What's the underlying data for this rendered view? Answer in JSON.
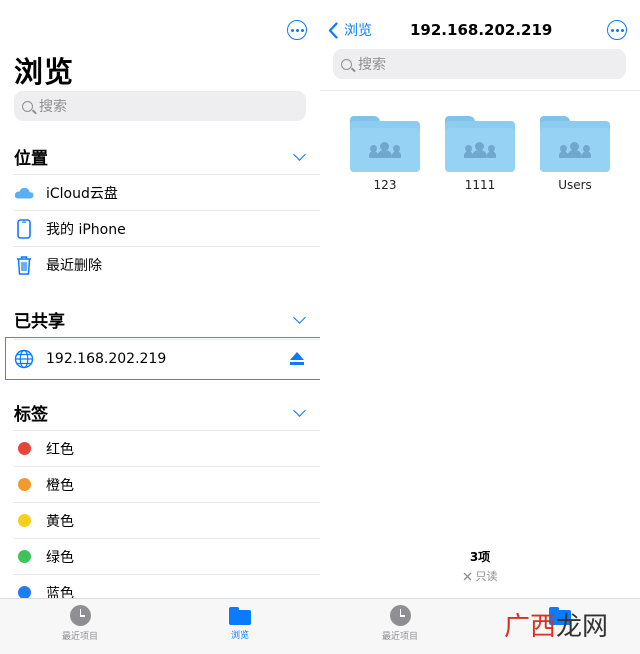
{
  "left": {
    "title": "浏览",
    "search_placeholder": "搜索",
    "sections": {
      "locations": {
        "label": "位置",
        "items": [
          {
            "label": "iCloud云盘",
            "icon": "icloud-icon"
          },
          {
            "label": "我的 iPhone",
            "icon": "iphone-icon"
          },
          {
            "label": "最近删除",
            "icon": "trash-icon"
          }
        ]
      },
      "shared": {
        "label": "已共享",
        "items": [
          {
            "label": "192.168.202.219",
            "icon": "globe-icon"
          }
        ]
      },
      "tags": {
        "label": "标签",
        "items": [
          {
            "label": "红色",
            "color": "#e5453a"
          },
          {
            "label": "橙色",
            "color": "#f29a2c"
          },
          {
            "label": "黄色",
            "color": "#f7ce1b"
          },
          {
            "label": "绿色",
            "color": "#3cc45b"
          },
          {
            "label": "蓝色",
            "color": "#1e7df0"
          }
        ]
      }
    }
  },
  "right": {
    "back_label": "浏览",
    "title": "192.168.202.219",
    "search_placeholder": "搜索",
    "folders": [
      {
        "name": "123"
      },
      {
        "name": "1111"
      },
      {
        "name": "Users"
      }
    ],
    "footer_count": "3项",
    "footer_status": "只读"
  },
  "tabbar": {
    "left_recent": "最近项目",
    "left_browse": "浏览",
    "right_recent": "最近项目"
  },
  "watermark": "广西龙网",
  "colors": {
    "accent": "#0a7aff",
    "highlight_box": "#d45b52"
  }
}
